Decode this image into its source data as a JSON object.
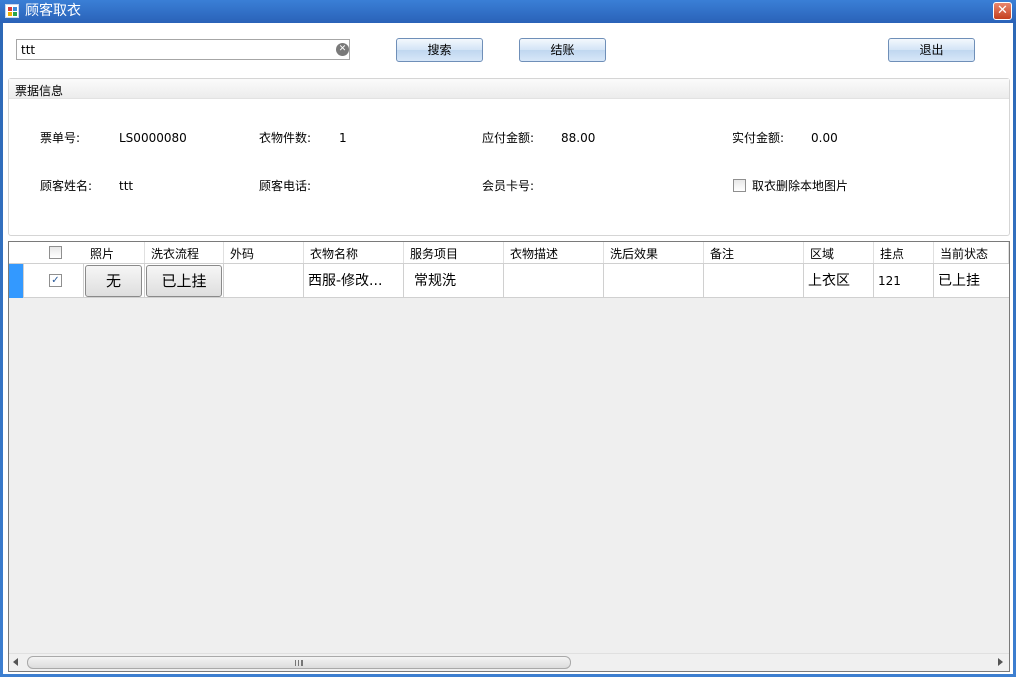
{
  "window": {
    "title": "顾客取衣",
    "close_label": "✕"
  },
  "toolbar": {
    "search_value": "ttt",
    "search_button": "搜索",
    "checkout_button": "结账",
    "exit_button": "退出"
  },
  "ticket": {
    "group_title": "票据信息",
    "ticket_no_label": "票单号:",
    "ticket_no": "LS0000080",
    "count_label": "衣物件数:",
    "count": "1",
    "payable_label": "应付金额:",
    "payable": "88.00",
    "paid_label": "实付金额:",
    "paid": "0.00",
    "customer_label": "顾客姓名:",
    "customer": "ttt",
    "phone_label": "顾客电话:",
    "phone": "",
    "card_label": "会员卡号:",
    "card": "",
    "delete_photo_label": "取衣删除本地图片"
  },
  "grid": {
    "headers": [
      "照片",
      "洗衣流程",
      "外码",
      "衣物名称",
      "服务项目",
      "衣物描述",
      "洗后效果",
      "备注",
      "区域",
      "挂点",
      "当前状态"
    ],
    "rows": [
      {
        "checked": true,
        "photo": "无",
        "process": "已上挂",
        "outer_code": "",
        "name": "西服-修改...",
        "service": "常规洗",
        "description": "",
        "effect": "",
        "remark": "",
        "area": "上衣区",
        "hook": "121",
        "status": "已上挂"
      }
    ]
  },
  "colors": {
    "titlebar": "#2a62b8",
    "selection": "#3399ff",
    "grid_background": "#efefef"
  }
}
